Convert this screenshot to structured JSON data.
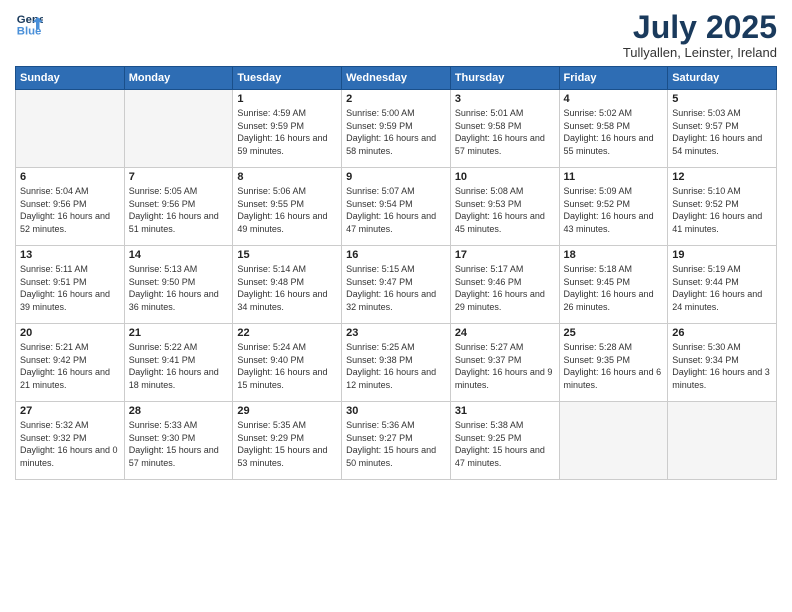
{
  "header": {
    "logo_line1": "General",
    "logo_line2": "Blue",
    "month_year": "July 2025",
    "location": "Tullyallen, Leinster, Ireland"
  },
  "days_of_week": [
    "Sunday",
    "Monday",
    "Tuesday",
    "Wednesday",
    "Thursday",
    "Friday",
    "Saturday"
  ],
  "weeks": [
    [
      {
        "day": "",
        "empty": true
      },
      {
        "day": "",
        "empty": true
      },
      {
        "day": "1",
        "sunrise": "Sunrise: 4:59 AM",
        "sunset": "Sunset: 9:59 PM",
        "daylight": "Daylight: 16 hours and 59 minutes."
      },
      {
        "day": "2",
        "sunrise": "Sunrise: 5:00 AM",
        "sunset": "Sunset: 9:59 PM",
        "daylight": "Daylight: 16 hours and 58 minutes."
      },
      {
        "day": "3",
        "sunrise": "Sunrise: 5:01 AM",
        "sunset": "Sunset: 9:58 PM",
        "daylight": "Daylight: 16 hours and 57 minutes."
      },
      {
        "day": "4",
        "sunrise": "Sunrise: 5:02 AM",
        "sunset": "Sunset: 9:58 PM",
        "daylight": "Daylight: 16 hours and 55 minutes."
      },
      {
        "day": "5",
        "sunrise": "Sunrise: 5:03 AM",
        "sunset": "Sunset: 9:57 PM",
        "daylight": "Daylight: 16 hours and 54 minutes."
      }
    ],
    [
      {
        "day": "6",
        "sunrise": "Sunrise: 5:04 AM",
        "sunset": "Sunset: 9:56 PM",
        "daylight": "Daylight: 16 hours and 52 minutes."
      },
      {
        "day": "7",
        "sunrise": "Sunrise: 5:05 AM",
        "sunset": "Sunset: 9:56 PM",
        "daylight": "Daylight: 16 hours and 51 minutes."
      },
      {
        "day": "8",
        "sunrise": "Sunrise: 5:06 AM",
        "sunset": "Sunset: 9:55 PM",
        "daylight": "Daylight: 16 hours and 49 minutes."
      },
      {
        "day": "9",
        "sunrise": "Sunrise: 5:07 AM",
        "sunset": "Sunset: 9:54 PM",
        "daylight": "Daylight: 16 hours and 47 minutes."
      },
      {
        "day": "10",
        "sunrise": "Sunrise: 5:08 AM",
        "sunset": "Sunset: 9:53 PM",
        "daylight": "Daylight: 16 hours and 45 minutes."
      },
      {
        "day": "11",
        "sunrise": "Sunrise: 5:09 AM",
        "sunset": "Sunset: 9:52 PM",
        "daylight": "Daylight: 16 hours and 43 minutes."
      },
      {
        "day": "12",
        "sunrise": "Sunrise: 5:10 AM",
        "sunset": "Sunset: 9:52 PM",
        "daylight": "Daylight: 16 hours and 41 minutes."
      }
    ],
    [
      {
        "day": "13",
        "sunrise": "Sunrise: 5:11 AM",
        "sunset": "Sunset: 9:51 PM",
        "daylight": "Daylight: 16 hours and 39 minutes."
      },
      {
        "day": "14",
        "sunrise": "Sunrise: 5:13 AM",
        "sunset": "Sunset: 9:50 PM",
        "daylight": "Daylight: 16 hours and 36 minutes."
      },
      {
        "day": "15",
        "sunrise": "Sunrise: 5:14 AM",
        "sunset": "Sunset: 9:48 PM",
        "daylight": "Daylight: 16 hours and 34 minutes."
      },
      {
        "day": "16",
        "sunrise": "Sunrise: 5:15 AM",
        "sunset": "Sunset: 9:47 PM",
        "daylight": "Daylight: 16 hours and 32 minutes."
      },
      {
        "day": "17",
        "sunrise": "Sunrise: 5:17 AM",
        "sunset": "Sunset: 9:46 PM",
        "daylight": "Daylight: 16 hours and 29 minutes."
      },
      {
        "day": "18",
        "sunrise": "Sunrise: 5:18 AM",
        "sunset": "Sunset: 9:45 PM",
        "daylight": "Daylight: 16 hours and 26 minutes."
      },
      {
        "day": "19",
        "sunrise": "Sunrise: 5:19 AM",
        "sunset": "Sunset: 9:44 PM",
        "daylight": "Daylight: 16 hours and 24 minutes."
      }
    ],
    [
      {
        "day": "20",
        "sunrise": "Sunrise: 5:21 AM",
        "sunset": "Sunset: 9:42 PM",
        "daylight": "Daylight: 16 hours and 21 minutes."
      },
      {
        "day": "21",
        "sunrise": "Sunrise: 5:22 AM",
        "sunset": "Sunset: 9:41 PM",
        "daylight": "Daylight: 16 hours and 18 minutes."
      },
      {
        "day": "22",
        "sunrise": "Sunrise: 5:24 AM",
        "sunset": "Sunset: 9:40 PM",
        "daylight": "Daylight: 16 hours and 15 minutes."
      },
      {
        "day": "23",
        "sunrise": "Sunrise: 5:25 AM",
        "sunset": "Sunset: 9:38 PM",
        "daylight": "Daylight: 16 hours and 12 minutes."
      },
      {
        "day": "24",
        "sunrise": "Sunrise: 5:27 AM",
        "sunset": "Sunset: 9:37 PM",
        "daylight": "Daylight: 16 hours and 9 minutes."
      },
      {
        "day": "25",
        "sunrise": "Sunrise: 5:28 AM",
        "sunset": "Sunset: 9:35 PM",
        "daylight": "Daylight: 16 hours and 6 minutes."
      },
      {
        "day": "26",
        "sunrise": "Sunrise: 5:30 AM",
        "sunset": "Sunset: 9:34 PM",
        "daylight": "Daylight: 16 hours and 3 minutes."
      }
    ],
    [
      {
        "day": "27",
        "sunrise": "Sunrise: 5:32 AM",
        "sunset": "Sunset: 9:32 PM",
        "daylight": "Daylight: 16 hours and 0 minutes."
      },
      {
        "day": "28",
        "sunrise": "Sunrise: 5:33 AM",
        "sunset": "Sunset: 9:30 PM",
        "daylight": "Daylight: 15 hours and 57 minutes."
      },
      {
        "day": "29",
        "sunrise": "Sunrise: 5:35 AM",
        "sunset": "Sunset: 9:29 PM",
        "daylight": "Daylight: 15 hours and 53 minutes."
      },
      {
        "day": "30",
        "sunrise": "Sunrise: 5:36 AM",
        "sunset": "Sunset: 9:27 PM",
        "daylight": "Daylight: 15 hours and 50 minutes."
      },
      {
        "day": "31",
        "sunrise": "Sunrise: 5:38 AM",
        "sunset": "Sunset: 9:25 PM",
        "daylight": "Daylight: 15 hours and 47 minutes."
      },
      {
        "day": "",
        "empty": true
      },
      {
        "day": "",
        "empty": true
      }
    ]
  ]
}
